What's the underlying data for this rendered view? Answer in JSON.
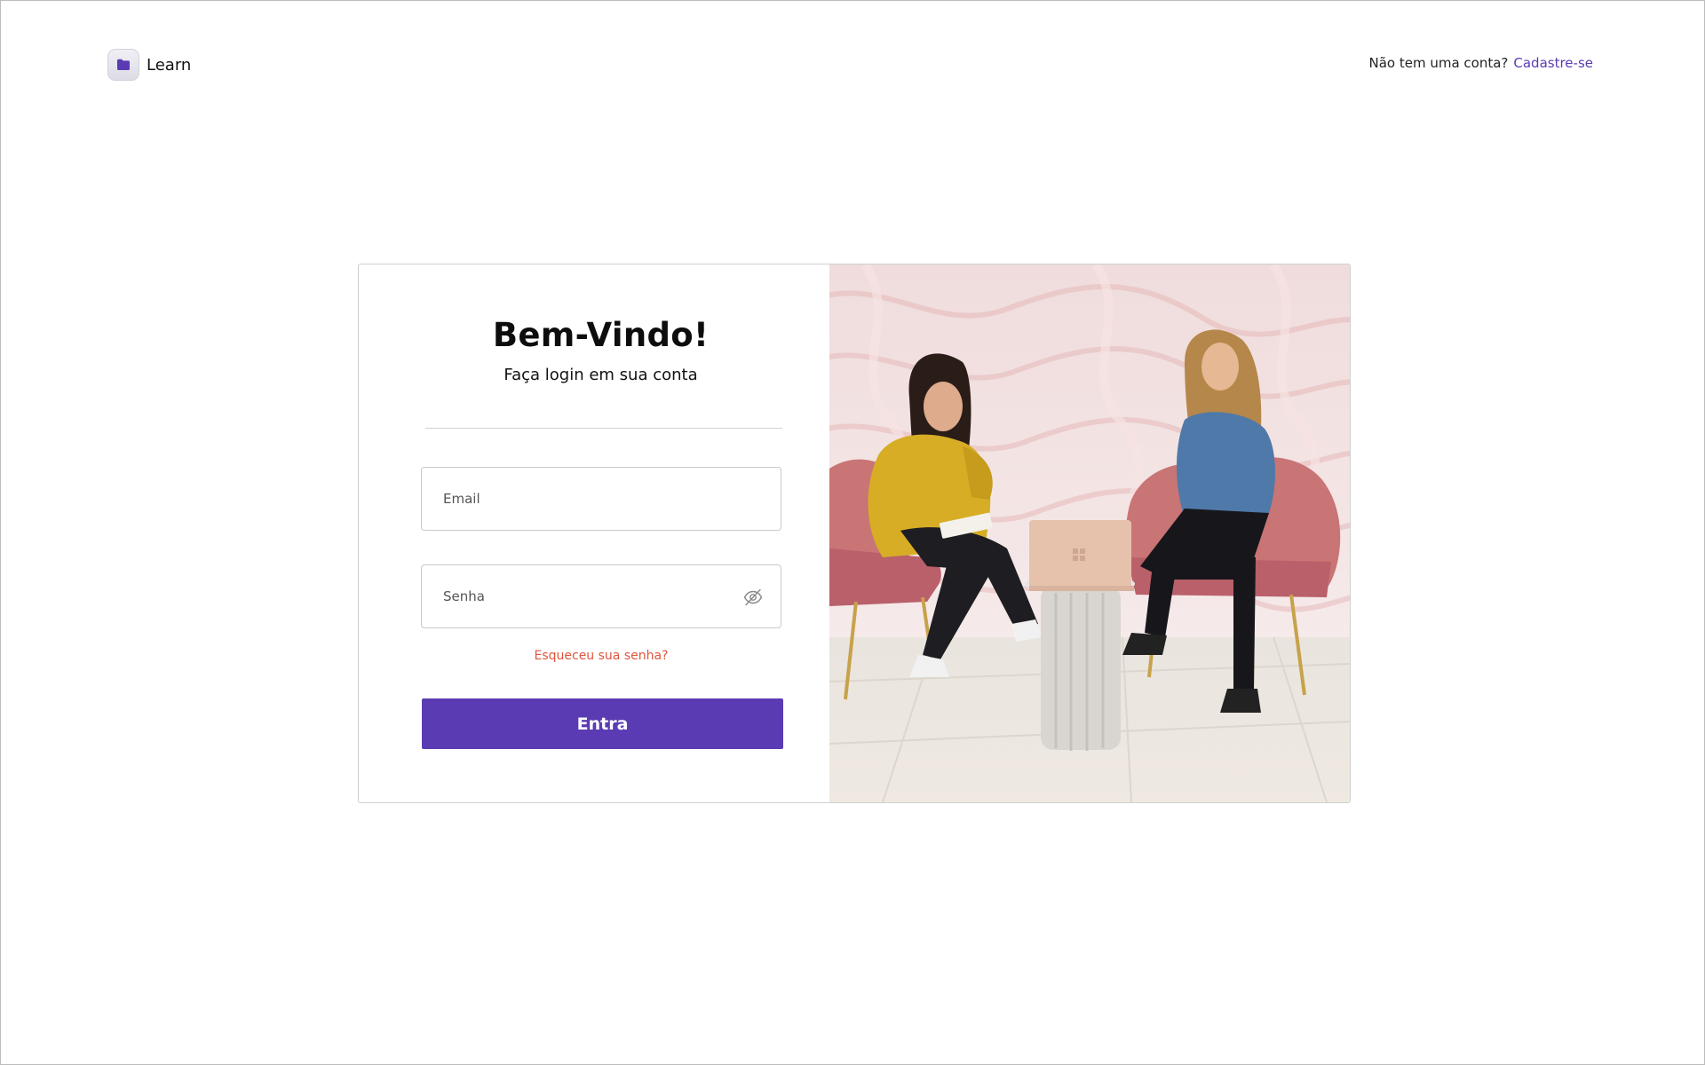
{
  "brand": {
    "name": "Learn",
    "icon": "folder-icon",
    "accent": "#5b3bb3"
  },
  "header": {
    "prompt": "Não tem uma conta?",
    "signup_link": "Cadastre-se"
  },
  "login": {
    "title": "Bem-Vindo!",
    "subtitle": "Faça login em sua conta",
    "email_placeholder": "Email",
    "password_placeholder": "Senha",
    "password_toggle_icon": "eye-off-icon",
    "forgot_link": "Esqueceu sua senha?",
    "submit_label": "Entra",
    "submit_color": "#5b3bb3",
    "forgot_color": "#e0553c"
  },
  "hero_image": {
    "subject": "photo-two-women-talking-laptop"
  }
}
